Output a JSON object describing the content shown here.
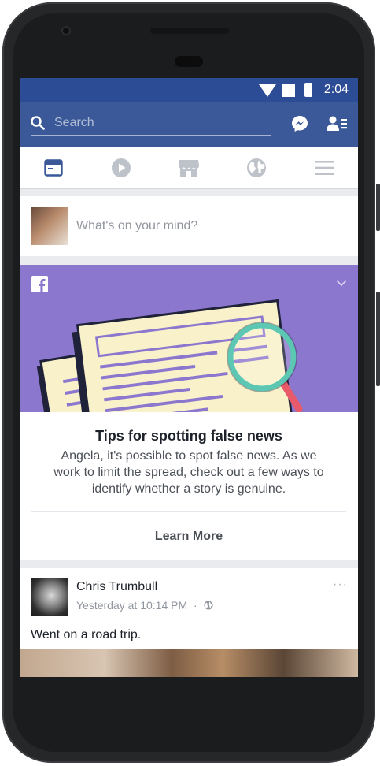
{
  "status_bar": {
    "time": "2:04"
  },
  "search": {
    "placeholder": "Search"
  },
  "nav": {
    "items": [
      {
        "name": "news-feed-icon"
      },
      {
        "name": "video-icon"
      },
      {
        "name": "marketplace-icon"
      },
      {
        "name": "notifications-globe-icon"
      },
      {
        "name": "menu-icon"
      }
    ],
    "active_color": "#3b5998",
    "inactive_color": "#bec2c9"
  },
  "composer": {
    "placeholder": "What's on your mind?"
  },
  "tips_card": {
    "title": "Tips for spotting false news",
    "description": "Angela, it's possible to spot false news. As we work to limit the spread, check out a few ways to identify whether a story is genuine.",
    "cta": "Learn More",
    "banner_color": "#8c77cf"
  },
  "post": {
    "author": "Chris Trumbull",
    "timestamp": "Yesterday at 10:14 PM",
    "separator": "·",
    "text": "Went on a road trip.",
    "more": "···"
  },
  "colors": {
    "brand": "#3b5998",
    "status_bar": "#2d4c96",
    "feed_bg": "#e9ebee"
  }
}
